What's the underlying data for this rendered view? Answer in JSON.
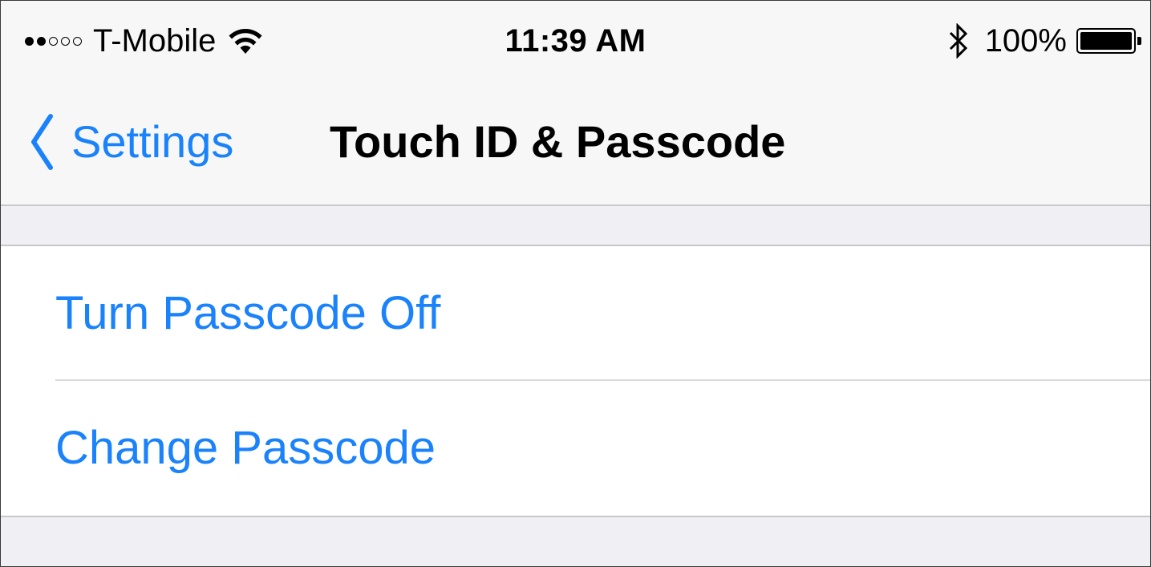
{
  "status_bar": {
    "signal_bars_filled": 2,
    "signal_bars_total": 5,
    "carrier": "T-Mobile",
    "wifi_icon": "wifi-icon",
    "time": "11:39 AM",
    "bluetooth_icon": "bluetooth-icon",
    "battery_percent": "100%",
    "battery_level": 1.0
  },
  "nav_bar": {
    "back_label": "Settings",
    "back_icon": "chevron-left-icon",
    "title": "Touch ID & Passcode"
  },
  "passcode_group": {
    "items": [
      {
        "label": "Turn Passcode Off"
      },
      {
        "label": "Change Passcode"
      }
    ]
  },
  "colors": {
    "accent": "#1a82fb",
    "background": "#efeff4",
    "bar_background": "#f7f7f7",
    "separator": "#c8c7cc"
  }
}
